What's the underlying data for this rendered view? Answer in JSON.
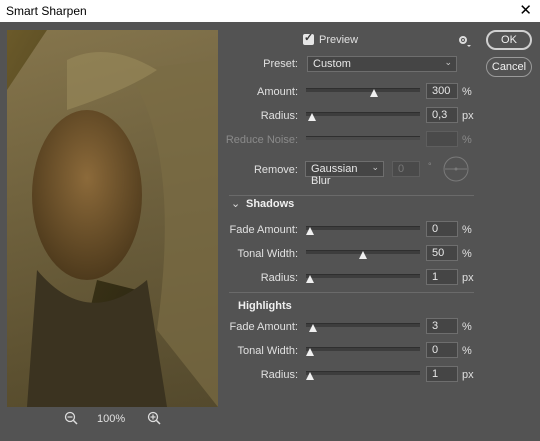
{
  "window": {
    "title": "Smart Sharpen",
    "close_glyph": "✕"
  },
  "preview_toggle": {
    "label": "Preview",
    "checked": true
  },
  "zoom": {
    "level": "100%"
  },
  "buttons": {
    "ok": "OK",
    "cancel": "Cancel"
  },
  "preset": {
    "label": "Preset:",
    "value": "Custom"
  },
  "sharpen": {
    "amount": {
      "label": "Amount:",
      "value": "300",
      "unit": "%",
      "level": 0.6
    },
    "radius": {
      "label": "Radius:",
      "value": "0,3",
      "unit": "px",
      "level": 0.02
    },
    "noise": {
      "label": "Reduce Noise:",
      "value": "",
      "unit": "%",
      "level": 0
    },
    "remove": {
      "label": "Remove:",
      "value": "Gaussian Blur",
      "angle": "0",
      "angle_unit": "°"
    }
  },
  "shadows": {
    "title": "Shadows",
    "fade": {
      "label": "Fade Amount:",
      "value": "0",
      "unit": "%",
      "level": 0
    },
    "tonal": {
      "label": "Tonal Width:",
      "value": "50",
      "unit": "%",
      "level": 0.5
    },
    "radius": {
      "label": "Radius:",
      "value": "1",
      "unit": "px",
      "level": 0
    }
  },
  "highlights": {
    "title": "Highlights",
    "fade": {
      "label": "Fade Amount:",
      "value": "3",
      "unit": "%",
      "level": 0.03
    },
    "tonal": {
      "label": "Tonal Width:",
      "value": "0",
      "unit": "%",
      "level": 0
    },
    "radius": {
      "label": "Radius:",
      "value": "1",
      "unit": "px",
      "level": 0
    }
  },
  "icons": {
    "close": "close-icon",
    "settings": "gear-icon",
    "zoom_out": "zoom-out-icon",
    "zoom_in": "zoom-in-icon",
    "collapse": "chevron-down-icon"
  }
}
